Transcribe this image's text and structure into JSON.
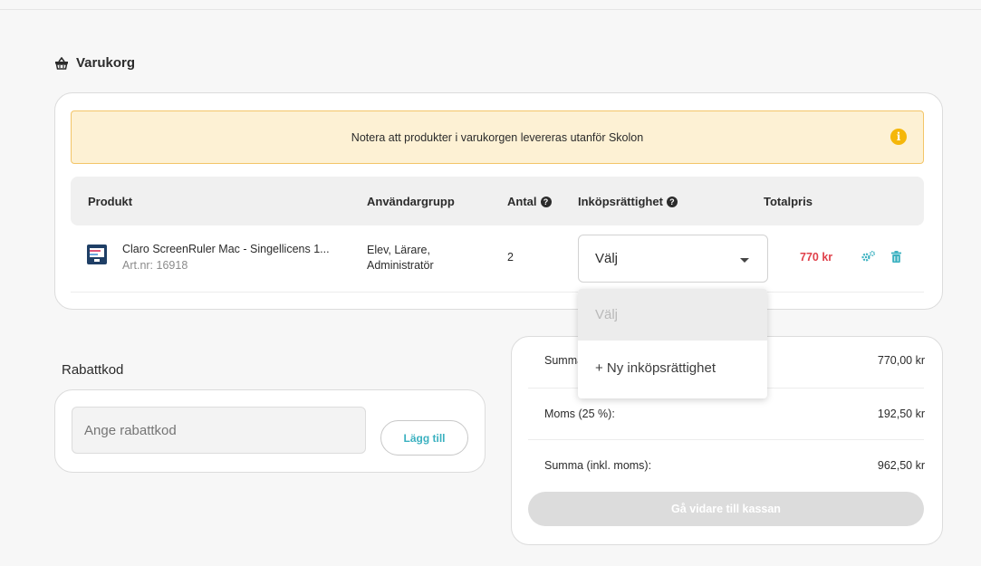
{
  "page": {
    "section_title": "Varukorg"
  },
  "notice": {
    "text": "Notera att produkter i varukorgen levereras utanför Skolon",
    "icon": "info-icon"
  },
  "table": {
    "headers": {
      "product": "Produkt",
      "usergroup": "Användargrupp",
      "quantity": "Antal",
      "purchase_right": "Inköpsrättighet",
      "total": "Totalpris"
    },
    "rows": [
      {
        "product_name": "Claro ScreenRuler Mac - Singellicens 1...",
        "article": "Art.nr: 16918",
        "usergroup": "Elev, Lärare, Administratör",
        "quantity": "2",
        "purchase_right_value": "Välj",
        "total": "770 kr"
      }
    ]
  },
  "dropdown": {
    "options": [
      "Välj",
      "+ Ny inköpsrättighet"
    ]
  },
  "discount": {
    "label": "Rabattkod",
    "placeholder": "Ange rabattkod",
    "button_label": "Lägg till"
  },
  "summary": {
    "rows": [
      {
        "label": "Summa",
        "value": "770,00 kr"
      },
      {
        "label": "Moms (25 %):",
        "value": "192,50 kr"
      },
      {
        "label": "Summa (inkl. moms):",
        "value": "962,50 kr"
      }
    ],
    "checkout_label": "Gå vidare till kassan"
  },
  "colors": {
    "accent": "#3bb1c0",
    "price": "#e0414b",
    "notice_bg": "#fdf1d4",
    "notice_border": "#f3c568",
    "info_icon": "#f5b70a"
  }
}
